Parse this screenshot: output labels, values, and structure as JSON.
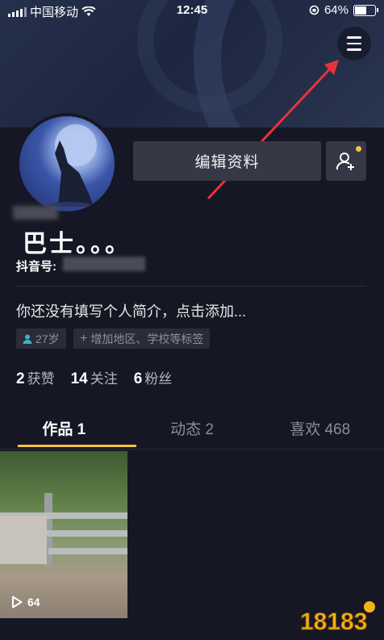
{
  "status_bar": {
    "carrier": "中国移动",
    "time": "12:45",
    "battery": "64%",
    "battery_level": 0.64
  },
  "profile": {
    "edit_button": "编辑资料",
    "username": "巴士。。。",
    "douyin_id_label": "抖音号:",
    "bio": "你还没有填写个人简介，点击添加...",
    "age_tag": "27岁",
    "add_tag": "增加地区、学校等标签"
  },
  "stats": [
    {
      "count": "2",
      "label": "获赞"
    },
    {
      "count": "14",
      "label": "关注"
    },
    {
      "count": "6",
      "label": "粉丝"
    }
  ],
  "tabs": [
    {
      "label": "作品 1",
      "active": true
    },
    {
      "label": "动态 2",
      "active": false
    },
    {
      "label": "喜欢 468",
      "active": false
    }
  ],
  "videos": [
    {
      "play_count": "64"
    }
  ],
  "watermark": "18183",
  "colors": {
    "accent": "#f5c043",
    "annotation_arrow": "#e8333a",
    "background": "#161724"
  }
}
